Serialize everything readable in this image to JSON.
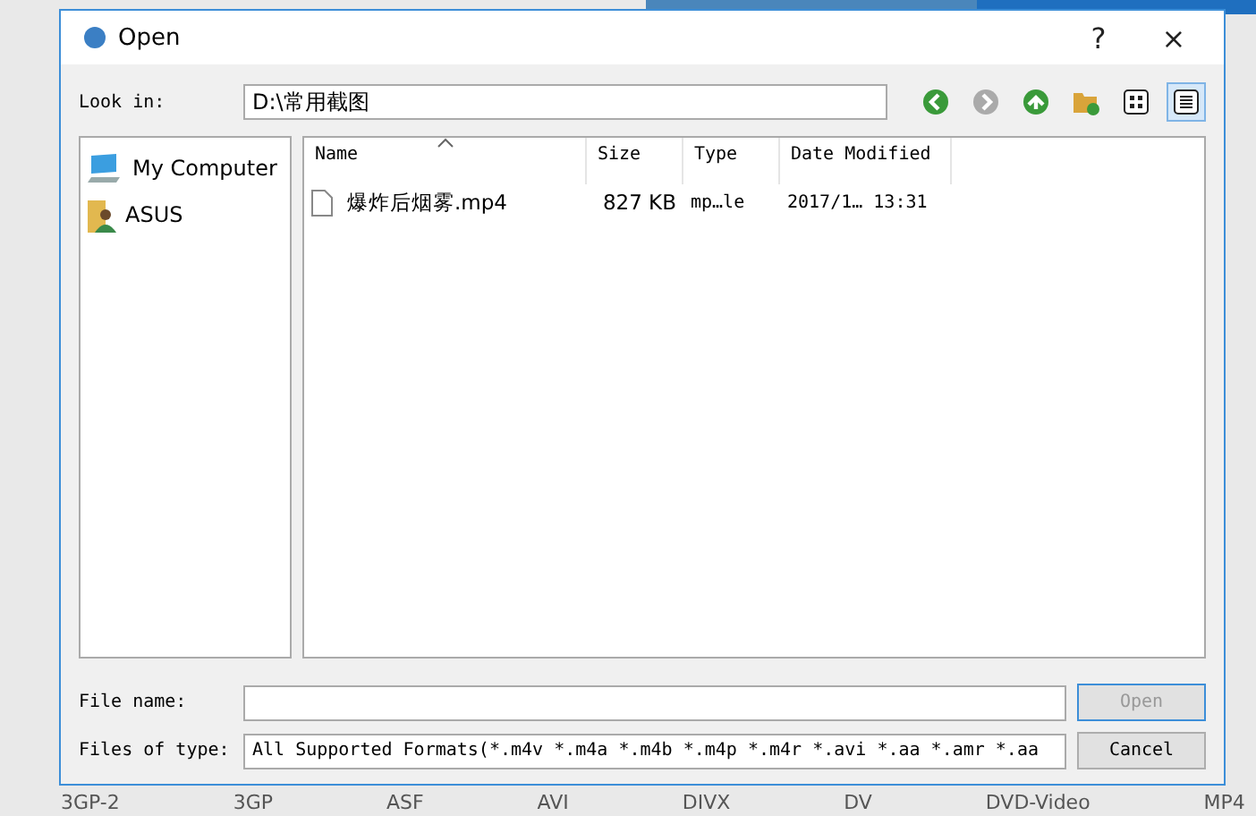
{
  "window": {
    "title": "Open",
    "buttons": [
      "?",
      "×"
    ]
  },
  "look_in": {
    "label": "Look in:",
    "value": "D:\\常用截图"
  },
  "toolbar": [
    {
      "kind": "back",
      "disabled": false
    },
    {
      "kind": "forward",
      "disabled": true
    },
    {
      "kind": "up",
      "disabled": false
    },
    {
      "kind": "new_folder",
      "disabled": false
    },
    {
      "kind": "icons_view",
      "selected": false
    },
    {
      "kind": "detail_view",
      "selected": true
    }
  ],
  "sidebar": {
    "items": [
      {
        "label": "My Computer",
        "kind": "computer"
      },
      {
        "label": "ASUS",
        "kind": "user"
      }
    ]
  },
  "table": {
    "columns": [
      {
        "label": "Name",
        "sorted": true
      },
      {
        "label": "Size",
        "sorted": false
      },
      {
        "label": "Type",
        "sorted": false
      },
      {
        "label": "Date Modified",
        "sorted": false
      }
    ],
    "rows": [
      {
        "cells": [
          "爆炸后烟雾.mp4",
          "827 KB",
          "mp…le",
          "2017/1… 13:31"
        ]
      }
    ]
  },
  "file_name": {
    "label": "File name:"
  },
  "file_type": {
    "label": "Files of type:",
    "value": "All Supported Formats(*.m4v *.m4a *.m4b *.m4p *.m4r *.avi *.aa *.amr *.aa"
  },
  "actions": [
    {
      "label": "Open",
      "disabled": true
    },
    {
      "label": "Cancel",
      "disabled": false
    }
  ],
  "background_formats": [
    "3GP-2",
    "3GP",
    "ASF",
    "AVI",
    "DIVX",
    "DV",
    "DVD-Video",
    "MP4"
  ]
}
